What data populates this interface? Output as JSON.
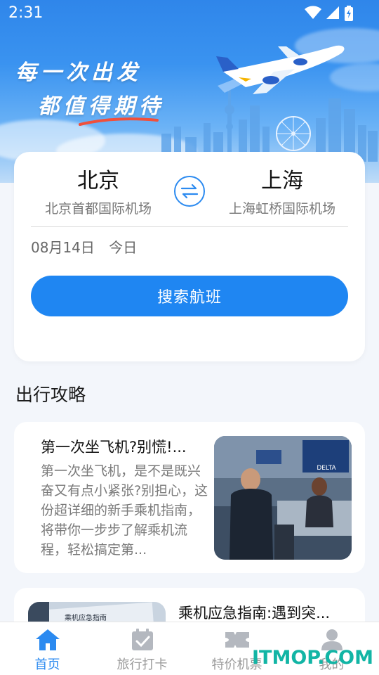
{
  "status_bar": {
    "time": "2:31"
  },
  "banner": {
    "slogan_line1": "每一次出发",
    "slogan_line2": "都值得期待"
  },
  "search": {
    "from_city": "北京",
    "from_airport": "北京首都国际机场",
    "to_city": "上海",
    "to_airport": "上海虹桥国际机场",
    "date": "08月14日",
    "day_label": "今日",
    "search_button": "搜索航班"
  },
  "guides": {
    "section_title": "出行攻略",
    "articles": [
      {
        "title": "第一次坐飞机?别慌!...",
        "description": "第一次坐飞机，是不是既兴奋又有点小紧张?别担心，这份超详细的新手乘机指南，将带你一步步了解乘机流程，轻松搞定第..."
      },
      {
        "title": "乘机应急指南:遇到突...",
        "thumb_caption": "乘机应急指南"
      }
    ]
  },
  "bottom_nav": {
    "items": [
      {
        "label": "首页",
        "icon": "home-icon",
        "active": true
      },
      {
        "label": "旅行打卡",
        "icon": "calendar-check-icon",
        "active": false
      },
      {
        "label": "特价机票",
        "icon": "ticket-icon",
        "active": false
      },
      {
        "label": "我的",
        "icon": "user-icon",
        "active": false
      }
    ]
  },
  "watermark": "ITMOP.COM",
  "colors": {
    "accent": "#1f86f2",
    "watermark": "#12b5a5"
  }
}
